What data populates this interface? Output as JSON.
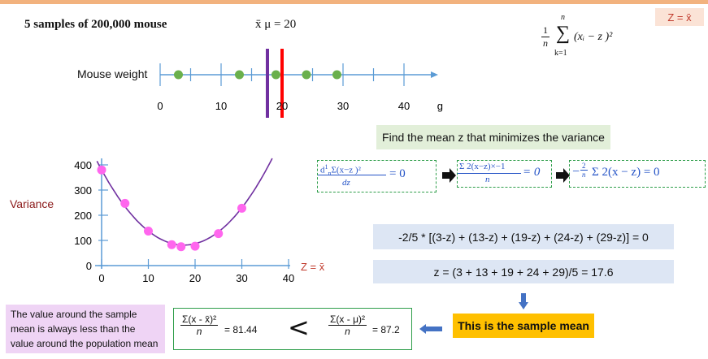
{
  "header": {
    "title": "5 samples of 200,000 mouse",
    "xbar_mu": "x̄ μ = 20",
    "z_badge": "Z = x̄"
  },
  "formula": {
    "prefix_num": "1",
    "prefix_den": "n",
    "sigma_top": "n",
    "sigma_bottom": "k=1",
    "body": "(xᵢ − z )²"
  },
  "number_line": {
    "label": "Mouse weight",
    "ticks": [
      "0",
      "10",
      "20",
      "30",
      "40"
    ],
    "unit": "g",
    "samples": [
      3,
      13,
      19,
      24,
      29
    ],
    "sample_mean": 17.6,
    "population_mean": 20,
    "colors": {
      "points": "#6ab04c",
      "sample_mean": "#7030a0",
      "population_mean": "#ff0000",
      "axis": "#5b9bd5"
    }
  },
  "goal": "Find the mean z that minimizes the variance",
  "derivation": {
    "step1_prefix": "d",
    "step1_frac_num": "1",
    "step1_frac_den": "n",
    "step1_sum": "Σ(x−z )²",
    "step1_den": "dz",
    "step1_eq": "= 0",
    "step2_num": "Σ 2(x−z)×−1",
    "step2_den": "n",
    "step2_eq": "= 0",
    "step3_sign": "−",
    "step3_frac_num": "2",
    "step3_frac_den": "n",
    "step3_body": "Σ 2(x − z) = 0",
    "expand": "-2/5 * [(3-z) + (13-z) + (19-z) + (24-z) + (29-z)] = 0",
    "solve": "z = (3 + 13 + 19 + 24 + 29)/5 = 17.6"
  },
  "chart_data": {
    "type": "scatter",
    "ylabel": "Variance",
    "xlabel": "Z = x̄",
    "x_ticks": [
      "0",
      "10",
      "20",
      "30",
      "40"
    ],
    "y_ticks": [
      "0",
      "100",
      "200",
      "300",
      "400"
    ],
    "xlim": [
      0,
      40
    ],
    "ylim": [
      0,
      400
    ],
    "points": [
      {
        "x": 0,
        "y": 380
      },
      {
        "x": 5,
        "y": 247
      },
      {
        "x": 10,
        "y": 137
      },
      {
        "x": 15,
        "y": 83
      },
      {
        "x": 17,
        "y": 75
      },
      {
        "x": 20,
        "y": 77
      },
      {
        "x": 25,
        "y": 127
      },
      {
        "x": 30,
        "y": 228
      }
    ],
    "curve": {
      "vertex_x": 17.6,
      "vertex_y": 81.44,
      "a": 1.0
    },
    "colors": {
      "points": "#ff66ee",
      "curve": "#7030a0",
      "axis": "#5b9bd5"
    }
  },
  "conclusion": {
    "note": "The value around the sample mean is always less than the value around the population mean",
    "left_num": "Σ(x - x̄)²",
    "left_den": "n",
    "left_val": "= 81.44",
    "less_than": "<",
    "right_num": "Σ(x - μ)²",
    "right_den": "n",
    "right_val": "= 87.2",
    "sample_mean_label": "This is the sample mean"
  }
}
